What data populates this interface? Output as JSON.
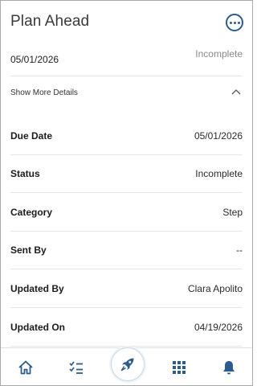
{
  "header": {
    "title": "Plan Ahead",
    "more_icon": "more-options-icon"
  },
  "summary": {
    "date": "05/01/2026",
    "status": "Incomplete"
  },
  "details_toggle": {
    "label": "Show More Details",
    "icon": "chevron-up-icon"
  },
  "details": [
    {
      "label": "Due Date",
      "value": "05/01/2026"
    },
    {
      "label": "Status",
      "value": "Incomplete"
    },
    {
      "label": "Category",
      "value": "Step"
    },
    {
      "label": "Sent By",
      "value": "--"
    },
    {
      "label": "Updated By",
      "value": "Clara Apolito"
    },
    {
      "label": "Updated On",
      "value": "04/19/2026"
    }
  ],
  "tabbar": {
    "items": [
      "home-icon",
      "task-list-icon",
      "rocket-icon",
      "apps-grid-icon",
      "bell-icon"
    ]
  },
  "colors": {
    "accent": "#2c5c8e",
    "muted": "#8a8a8a",
    "divider": "#e3e3e3"
  }
}
